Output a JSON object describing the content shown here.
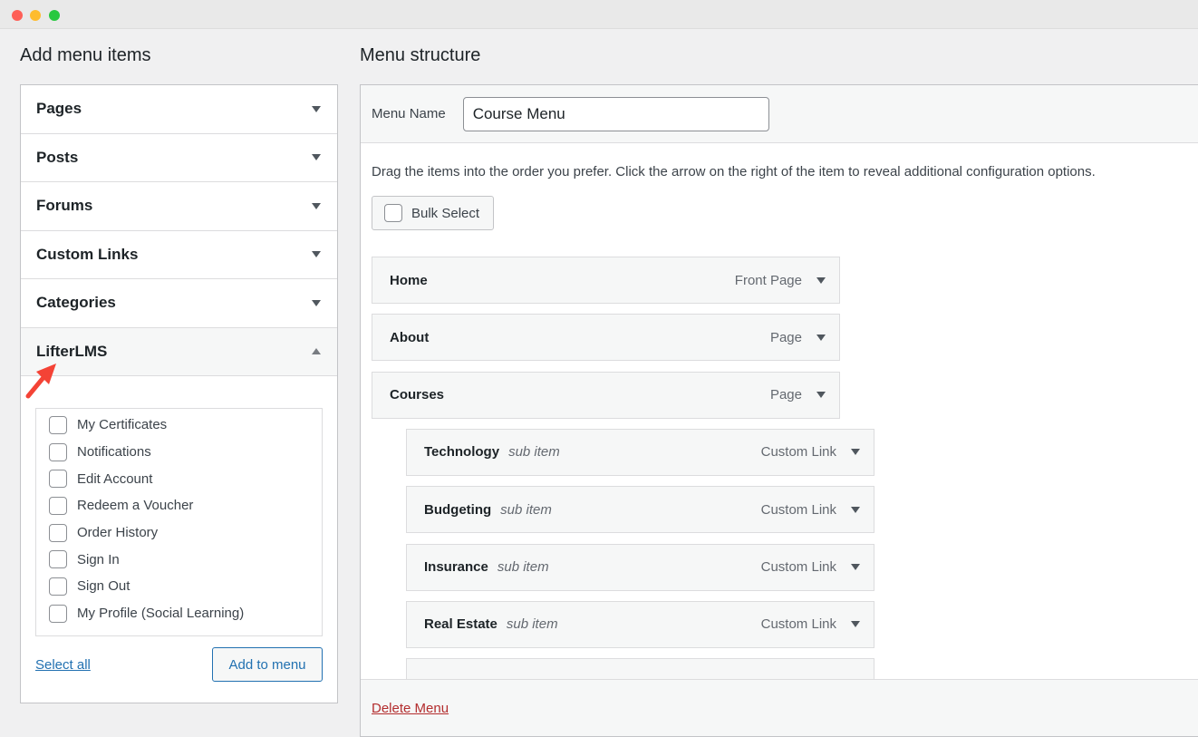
{
  "window": {
    "controls": {
      "close": "#fe5f57",
      "minimize": "#febc2e",
      "zoom": "#28c840"
    }
  },
  "left": {
    "title": "Add menu items",
    "sections": [
      {
        "label": "Pages"
      },
      {
        "label": "Posts"
      },
      {
        "label": "Forums"
      },
      {
        "label": "Custom Links"
      },
      {
        "label": "Categories"
      },
      {
        "label": "LifterLMS",
        "open": true
      }
    ],
    "items": [
      "My Certificates",
      "Notifications",
      "Edit Account",
      "Redeem a Voucher",
      "Order History",
      "Sign In",
      "Sign Out",
      "My Profile (Social Learning)"
    ],
    "select_all": "Select all",
    "add_button": "Add to menu"
  },
  "right": {
    "title": "Menu structure",
    "name_label": "Menu Name",
    "name_value": "Course Menu",
    "instructions": "Drag the items into the order you prefer. Click the arrow on the right of the item to reveal additional configuration options.",
    "bulk_select": "Bulk Select",
    "menu_items": [
      {
        "title": "Home",
        "sub": "",
        "type": "Front Page"
      },
      {
        "title": "About",
        "sub": "",
        "type": "Page"
      },
      {
        "title": "Courses",
        "sub": "",
        "type": "Page"
      },
      {
        "title": "Technology",
        "sub": "sub item",
        "type": "Custom Link"
      },
      {
        "title": "Budgeting",
        "sub": "sub item",
        "type": "Custom Link"
      },
      {
        "title": "Insurance",
        "sub": "sub item",
        "type": "Custom Link"
      },
      {
        "title": "Real Estate",
        "sub": "sub item",
        "type": "Custom Link"
      }
    ],
    "delete_menu": "Delete Menu"
  },
  "annotation": {
    "arrow_color": "#f44336"
  }
}
